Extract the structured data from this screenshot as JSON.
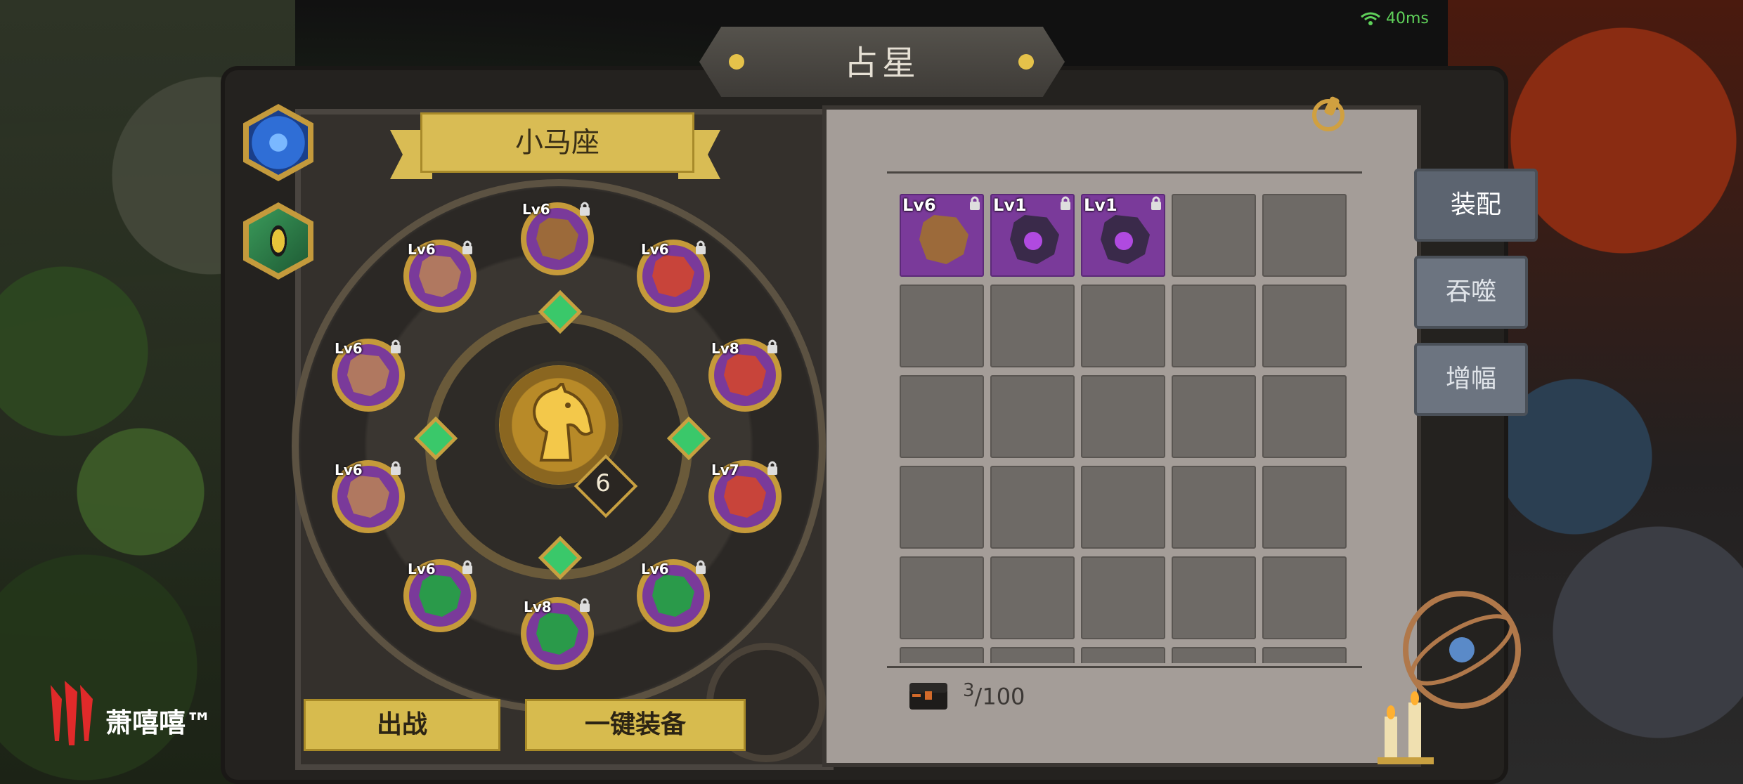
{
  "status": {
    "ping": "40ms"
  },
  "title": "占星",
  "constellation": {
    "name": "小马座",
    "level": "6",
    "tabs": [
      {
        "icon": "swirl-constellation-icon",
        "color": "#2f6ed6"
      },
      {
        "icon": "eye-constellation-icon",
        "color": "#3a9a5a"
      }
    ],
    "slots": [
      {
        "level": "Lv6",
        "stone": "brown-rune-stone",
        "color": "#9c6a3a"
      },
      {
        "level": "Lv6",
        "stone": "sword-stone",
        "color": "#b07860"
      },
      {
        "level": "Lv6",
        "stone": "red-sword-stone",
        "color": "#c8443a"
      },
      {
        "level": "Lv6",
        "stone": "sword-stone",
        "color": "#b07860"
      },
      {
        "level": "Lv8",
        "stone": "red-sword-stone",
        "color": "#c8443a"
      },
      {
        "level": "Lv6",
        "stone": "sword-stone",
        "color": "#b07860"
      },
      {
        "level": "Lv7",
        "stone": "red-sword-stone",
        "color": "#c8443a"
      },
      {
        "level": "Lv6",
        "stone": "green-heart-stone",
        "color": "#2a9a4a"
      },
      {
        "level": "Lv6",
        "stone": "green-heart-stone",
        "color": "#2a9a4a"
      },
      {
        "level": "Lv8",
        "stone": "green-heart-stone",
        "color": "#2a9a4a"
      }
    ]
  },
  "buttons": {
    "deploy": "出战",
    "equip_all": "一键装备"
  },
  "side_tabs": {
    "equip": "装配",
    "devour": "吞噬",
    "amplify": "增幅"
  },
  "inventory": {
    "items": [
      {
        "level": "Lv6",
        "stone": "brown-rune-stone",
        "color": "#9c6a3a"
      },
      {
        "level": "Lv1",
        "stone": "purple-moon-stone",
        "color": "#3a2a4a"
      },
      {
        "level": "Lv1",
        "stone": "purple-moon-stone",
        "color": "#3a2a4a"
      }
    ],
    "count": "3",
    "capacity": "/100"
  },
  "brand": {
    "name": "萧嘻嘻™"
  }
}
